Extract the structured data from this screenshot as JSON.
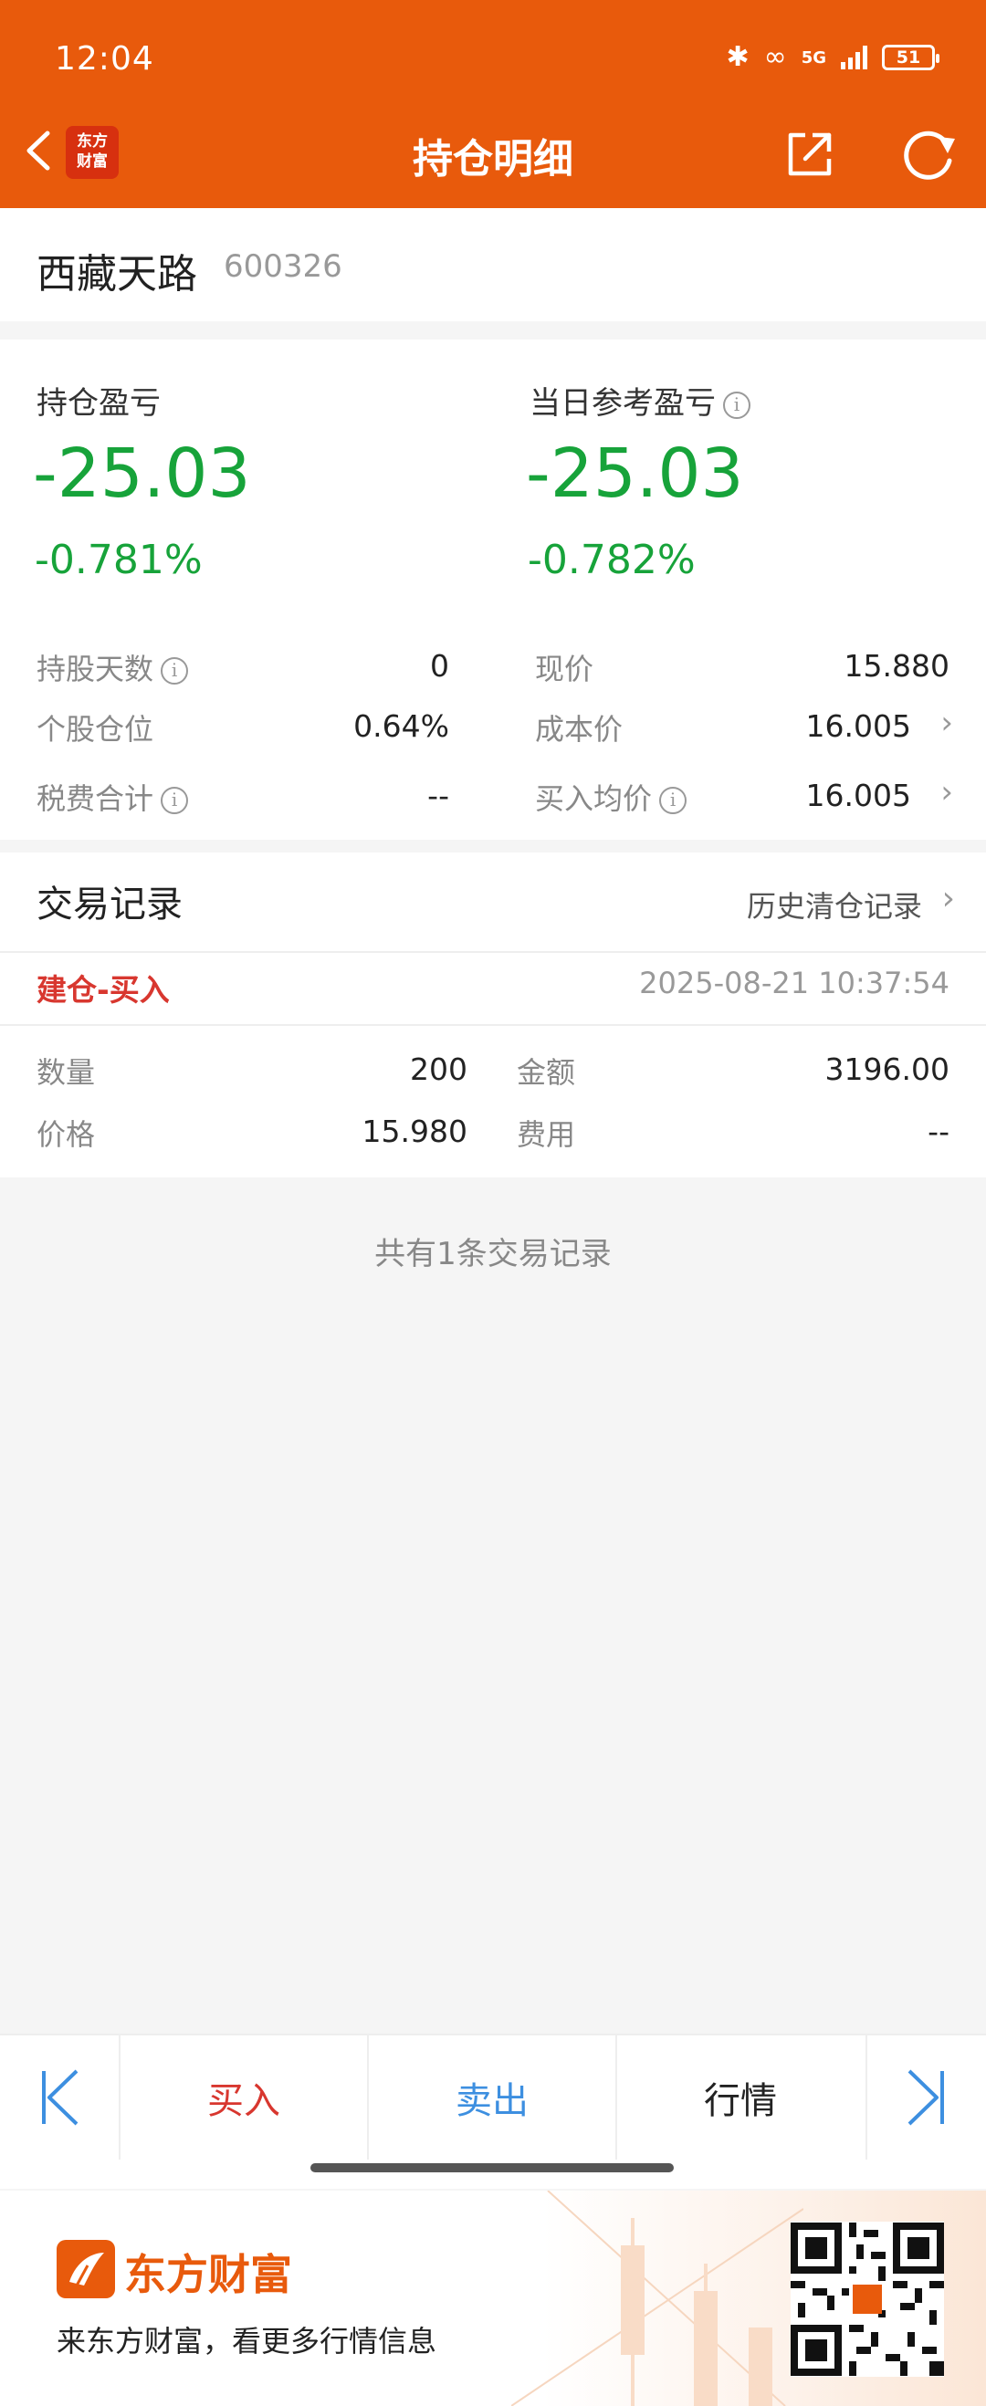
{
  "status": {
    "time": "12:04",
    "network": "5G",
    "battery": "51"
  },
  "header": {
    "title": "持仓明细",
    "brand_mini": [
      "东方",
      "财富"
    ]
  },
  "stock": {
    "name": "西藏天路",
    "code": "600326"
  },
  "pnl": {
    "holding_label": "持仓盈亏",
    "holding_value": "-25.03",
    "holding_pct": "-0.781%",
    "daily_label": "当日参考盈亏",
    "daily_value": "-25.03",
    "daily_pct": "-0.782%",
    "value_color": "#17a33a"
  },
  "details": {
    "days_label": "持股天数",
    "days_value": "0",
    "position_label": "个股仓位",
    "position_value": "0.64%",
    "tax_label": "税费合计",
    "tax_value": "--",
    "price_label": "现价",
    "price_value": "15.880",
    "cost_label": "成本价",
    "cost_value": "16.005",
    "avg_label": "买入均价",
    "avg_value": "16.005"
  },
  "trades": {
    "title": "交易记录",
    "history_link": "历史清仓记录",
    "records": [
      {
        "type": "建仓-买入",
        "time": "2025-08-21 10:37:54",
        "qty_label": "数量",
        "qty": "200",
        "amount_label": "金额",
        "amount": "3196.00",
        "price_label": "价格",
        "price": "15.980",
        "fee_label": "费用",
        "fee": "--"
      }
    ],
    "summary": "共有1条交易记录"
  },
  "bottom": {
    "buy": "买入",
    "sell": "卖出",
    "quote": "行情"
  },
  "ad": {
    "brand": "东方财富",
    "slogan": "来东方财富，看更多行情信息"
  },
  "colors": {
    "brand": "#e85a0c",
    "gain_down": "#17a33a",
    "buy_red": "#d8372f",
    "sell_blue": "#3d8fe0"
  }
}
